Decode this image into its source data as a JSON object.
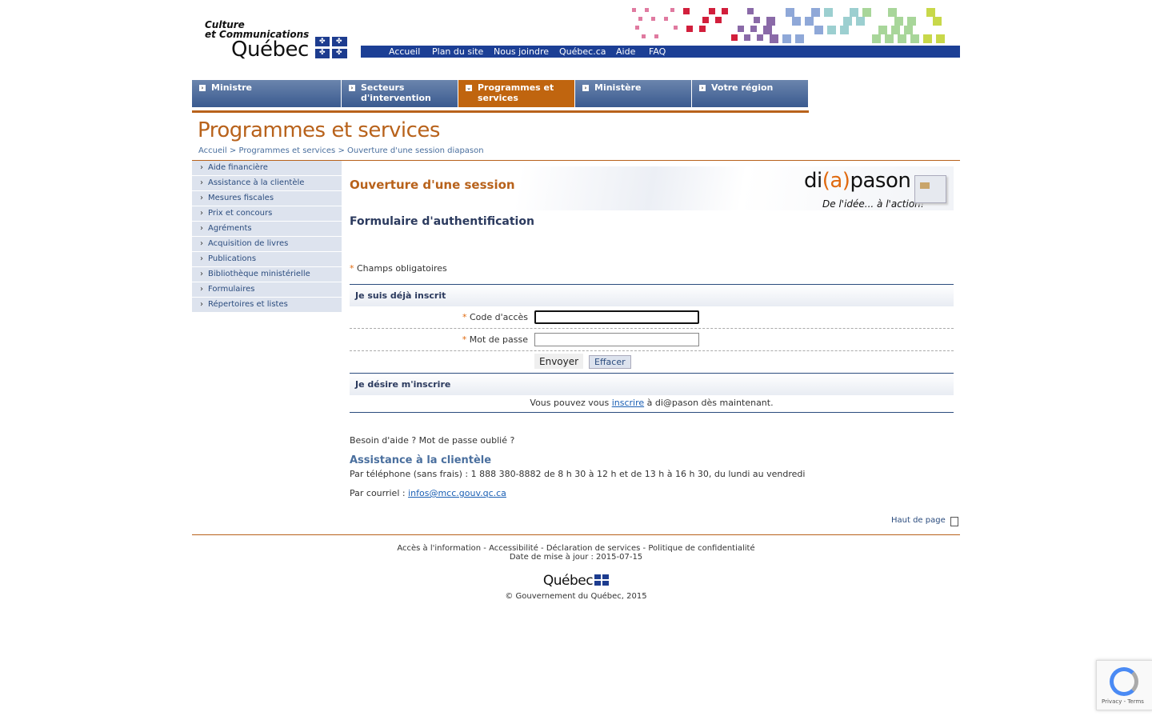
{
  "logo": {
    "line1": "Culture",
    "line2": "et Communications",
    "line3": "Québec"
  },
  "topnav": [
    "Accueil",
    "Plan du site",
    "Nous joindre",
    "Québec.ca",
    "Aide",
    "FAQ"
  ],
  "tabs": [
    {
      "label": "Ministre",
      "active": false
    },
    {
      "label": "Secteurs d'intervention",
      "active": false
    },
    {
      "label": "Programmes et services",
      "active": true
    },
    {
      "label": "Ministère",
      "active": false
    },
    {
      "label": "Votre région",
      "active": false
    }
  ],
  "page_title": "Programmes et services",
  "breadcrumb": {
    "items": [
      "Accueil",
      "Programmes et services",
      "Ouverture d'une session diapason"
    ],
    "sep": ">"
  },
  "left_menu": [
    "Aide financière",
    "Assistance à la clientèle",
    "Mesures fiscales",
    "Prix et concours",
    "Agréments",
    "Acquisition de livres",
    "Publications",
    "Bibliothèque ministérielle",
    "Formulaires",
    "Répertoires et listes"
  ],
  "banner": {
    "title": "Ouverture d'une session",
    "logo_pre": "di",
    "logo_at": "(a)",
    "logo_post": "pason",
    "slogan": "De l'idée... à l'action!"
  },
  "form": {
    "heading": "Formulaire d'authentification",
    "required_note": "Champs obligatoires",
    "required_mark": "*",
    "section1": "Je suis déjà inscrit",
    "access_label": "Code d'accès",
    "access_value": "",
    "password_label": "Mot de passe",
    "password_value": "",
    "send_label": "Envoyer",
    "clear_label": "Effacer",
    "section2": "Je désire m'inscrire",
    "signup_pre": "Vous pouvez vous",
    "signup_link": "inscrire",
    "signup_post": "à di@pason dès maintenant."
  },
  "help": {
    "question": "Besoin d'aide ? Mot de passe oublié ?",
    "title": "Assistance à la clientèle",
    "phone": "Par téléphone (sans frais) : 1 888 380-8882 de 8 h 30 à 12 h et de 13 h à 16 h 30, du lundi au vendredi",
    "mail_label": "Par courriel :",
    "mail": "infos@mcc.gouv.qc.ca"
  },
  "back_to_top": "Haut de page",
  "footer": {
    "links": [
      "Accès à l'information",
      "Accessibilité",
      "Déclaration de services",
      "Politique de confidentialité"
    ],
    "updated_label": "Date de mise à jour :",
    "updated": "2015-07-15",
    "brand": "Québec",
    "copyright": "© Gouvernement du Québec, 2015"
  },
  "recaptcha": {
    "privacy": "Privacy",
    "terms": "Terms"
  },
  "colors": {
    "brand_blue": "#1c3f95",
    "accent_orange": "#b8621b",
    "tab_blue": "#4a6a9c"
  }
}
